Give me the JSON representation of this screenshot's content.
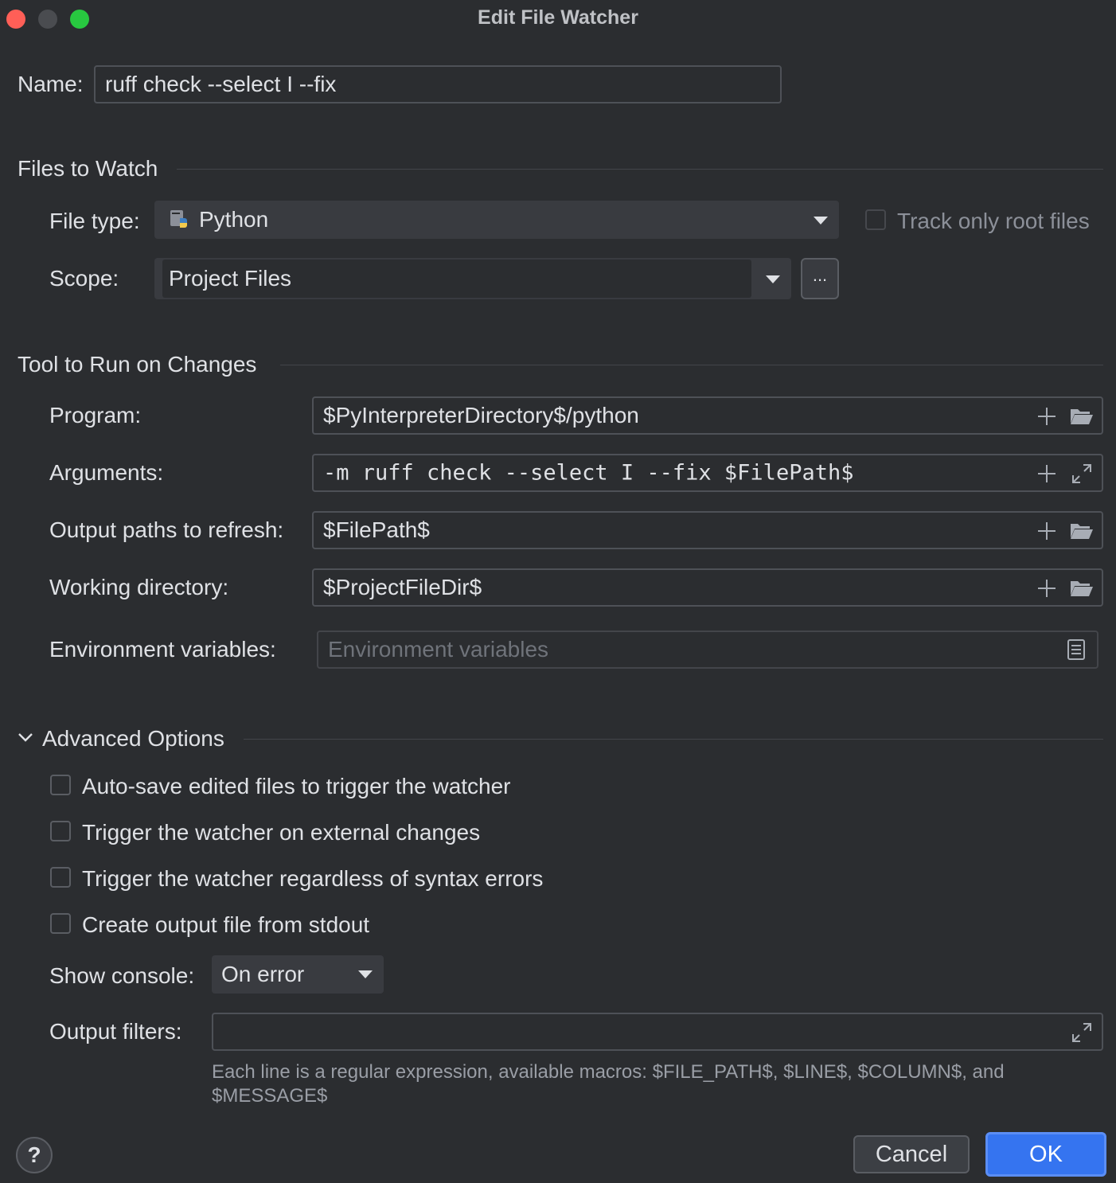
{
  "window": {
    "title": "Edit File Watcher"
  },
  "name": {
    "label": "Name:",
    "value": "ruff check --select I --fix"
  },
  "files_to_watch": {
    "heading": "Files to Watch",
    "file_type_label": "File type:",
    "file_type_value": "Python",
    "track_root_label": "Track only root files",
    "scope_label": "Scope:",
    "scope_value": "Project Files",
    "scope_browse": "..."
  },
  "tool": {
    "heading": "Tool to Run on Changes",
    "program_label": "Program:",
    "program_value": "$PyInterpreterDirectory$/python",
    "arguments_label": "Arguments:",
    "arguments_value": "-m ruff check --select I --fix $FilePath$",
    "output_paths_label": "Output paths to refresh:",
    "output_paths_value": "$FilePath$",
    "working_dir_label": "Working directory:",
    "working_dir_value": "$ProjectFileDir$",
    "env_label": "Environment variables:",
    "env_placeholder": "Environment variables"
  },
  "advanced": {
    "heading": "Advanced Options",
    "options": [
      {
        "label": "Auto-save edited files to trigger the watcher",
        "checked": false
      },
      {
        "label": "Trigger the watcher on external changes",
        "checked": false
      },
      {
        "label": "Trigger the watcher regardless of syntax errors",
        "checked": false
      },
      {
        "label": "Create output file from stdout",
        "checked": false
      }
    ],
    "show_console_label": "Show console:",
    "show_console_value": "On error",
    "output_filters_label": "Output filters:",
    "output_filters_value": "",
    "hint": "Each line is a regular expression, available macros: $FILE_PATH$, $LINE$, $COLUMN$, and $MESSAGE$"
  },
  "footer": {
    "help": "?",
    "cancel": "Cancel",
    "ok": "OK"
  },
  "colors": {
    "accent": "#3574f0",
    "background": "#2b2d30",
    "field_border": "#4e5157"
  },
  "icons": [
    "python-file-icon",
    "dropdown-caret-icon",
    "plus-icon",
    "folder-icon",
    "expand-icon",
    "document-icon",
    "chevron-down-icon"
  ]
}
